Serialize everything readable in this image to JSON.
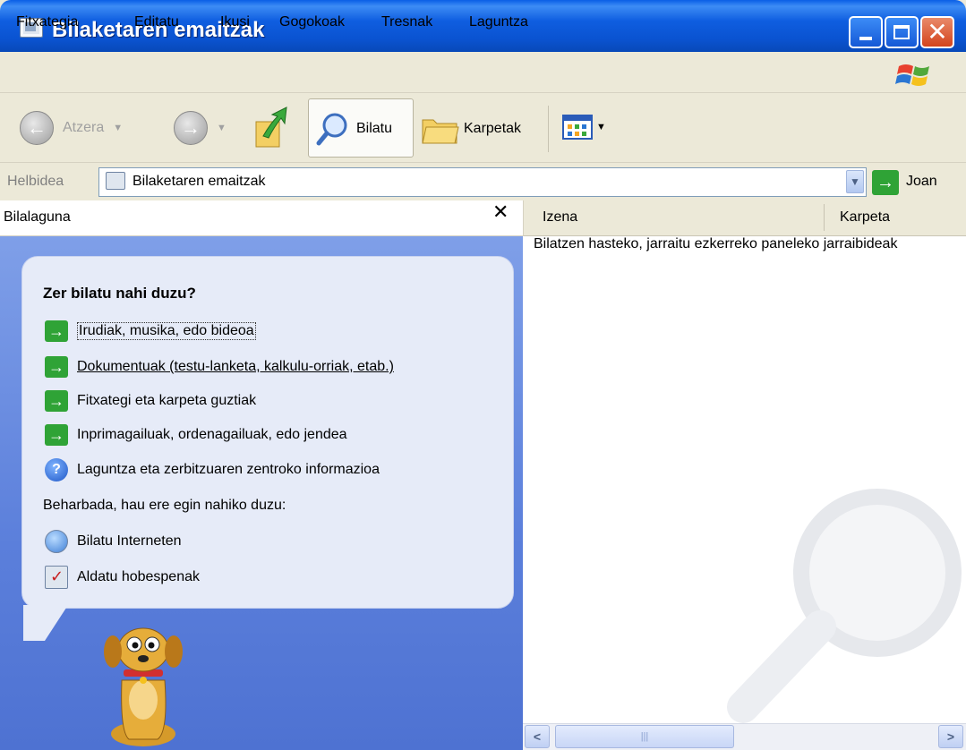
{
  "window": {
    "title": "Bilaketaren emaitzak"
  },
  "menu": [
    {
      "label": "Fitxategia"
    },
    {
      "label": "Editatu"
    },
    {
      "label": "Ikusi"
    },
    {
      "label": "Gogokoak"
    },
    {
      "label": "Tresnak"
    },
    {
      "label": "Laguntza"
    }
  ],
  "toolbar": {
    "back_label": "Atzera",
    "search_label": "Bilatu",
    "folders_label": "Karpetak"
  },
  "address": {
    "label": "Helbidea",
    "value": "Bilaketaren emaitzak",
    "go_label": "Joan"
  },
  "left_pane": {
    "title": "Bilalaguna",
    "close_glyph": "✕",
    "question": "Zer bilatu nahi duzu?",
    "options": [
      {
        "label": "Irudiak, musika, edo bideoa",
        "icon": "green-arrow-icon"
      },
      {
        "label": "Dokumentuak (testu-lanketa, kalkulu-orriak, etab.)",
        "icon": "green-arrow-icon"
      },
      {
        "label": "Fitxategi eta karpeta guztiak",
        "icon": "green-arrow-icon"
      },
      {
        "label": "Inprimagailuak, ordenagailuak, edo jendea",
        "icon": "green-arrow-icon"
      },
      {
        "label": "Laguntza eta zerbitzuaren zentroko informazioa",
        "icon": "help-icon"
      }
    ],
    "also_label": "Beharbada, hau ere egin nahiko duzu:",
    "extras": [
      {
        "label": "Bilatu Interneten",
        "icon": "internet-search-icon"
      },
      {
        "label": "Aldatu hobespenak",
        "icon": "preferences-icon"
      }
    ]
  },
  "results": {
    "columns": [
      "Izena",
      "Karpeta"
    ],
    "hint": "Bilatzen hasteko, jarraitu ezkerreko paneleko jarraibideak"
  },
  "colors": {
    "titlebar": "#0A53D1",
    "pane_blue": "#5B7FDB",
    "go_green": "#2FA336"
  }
}
